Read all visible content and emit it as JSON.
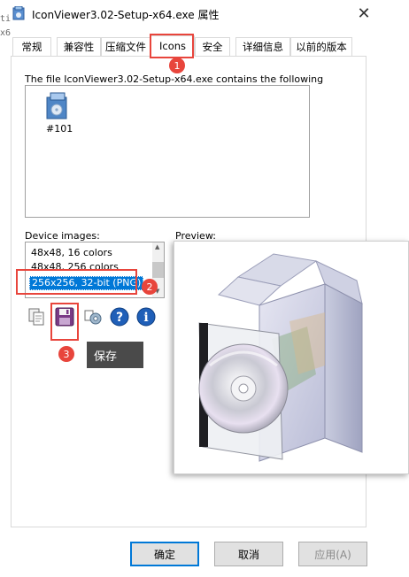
{
  "window": {
    "title": "IconViewer3.02-Setup-x64.exe 属性",
    "close_glyph": "✕"
  },
  "side_fragments": [
    "ti",
    "x6"
  ],
  "tabs": [
    {
      "label": "常规"
    },
    {
      "label": "兼容性"
    },
    {
      "label": "压缩文件"
    },
    {
      "label": "Icons",
      "active": true
    },
    {
      "label": "安全"
    },
    {
      "label": "详细信息"
    },
    {
      "label": "以前的版本"
    }
  ],
  "icons_panel": {
    "description": "The file IconViewer3.02-Setup-x64.exe contains the following",
    "icon_label": "#101",
    "device_images_label": "Device images:",
    "preview_label": "Preview:",
    "device_images": [
      "48x48, 16 colors",
      "48x48, 256 colors",
      "256x256, 32-bit (PNG)"
    ],
    "selected_device_image": "256x256, 32-bit (PNG)",
    "toolbar_icons": [
      "copy-icon",
      "save-icon",
      "settings-icon",
      "help-icon",
      "info-icon"
    ]
  },
  "annotations": {
    "badge1": "1",
    "badge2": "2",
    "badge3": "3",
    "tooltip": "保存",
    "accent_color": "#e8453c"
  },
  "buttons": {
    "ok": "确定",
    "cancel": "取消",
    "apply": "应用(A)"
  },
  "colors": {
    "selection": "#0078d7",
    "tooltip_bg": "#4a4a4a"
  }
}
